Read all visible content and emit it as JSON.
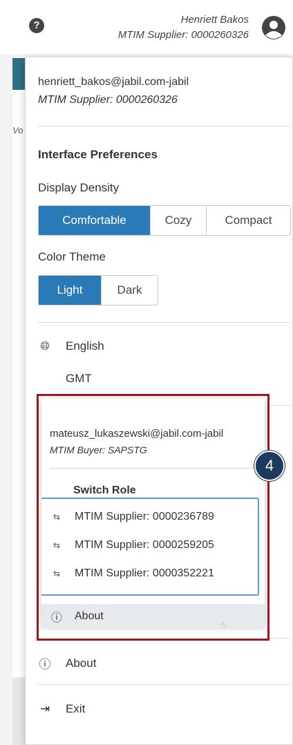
{
  "header": {
    "help_icon": "question-circle-icon",
    "user_name": "Henriett Bakos",
    "user_role": "MTIM Supplier: 0000260326",
    "user_icon": "user-circle-icon"
  },
  "background": {
    "partial_text": "Vo"
  },
  "menu": {
    "email": "henriett_bakos@jabil.com-jabil",
    "role": "MTIM Supplier: 0000260326",
    "prefs_heading": "Interface Preferences",
    "density_label": "Display Density",
    "density_options": [
      "Comfortable",
      "Cozy",
      "Compact"
    ],
    "density_selected": "Comfortable",
    "theme_label": "Color Theme",
    "theme_options": [
      "Light",
      "Dark"
    ],
    "theme_selected": "Light",
    "language": "English",
    "language_icon": "globe-icon",
    "timezone": "GMT",
    "about": "About",
    "about_icon": "info-circle-icon",
    "exit": "Exit",
    "exit_icon": "sign-out-icon"
  },
  "inset": {
    "email": "mateusz_lukaszewski@jabil.com-jabil",
    "role": "MTIM Buyer: SAPSTG",
    "switch_role": "Switch Role",
    "roles": [
      "MTIM Supplier: 0000236789",
      "MTIM Supplier: 0000259205",
      "MTIM Supplier: 0000352221"
    ],
    "about": "About",
    "badge": "4",
    "highlight_color": "#a5161b"
  },
  "colors": {
    "accent": "#2a7ab8",
    "teal": "#2f6f84",
    "badge": "#1e3a5f"
  }
}
